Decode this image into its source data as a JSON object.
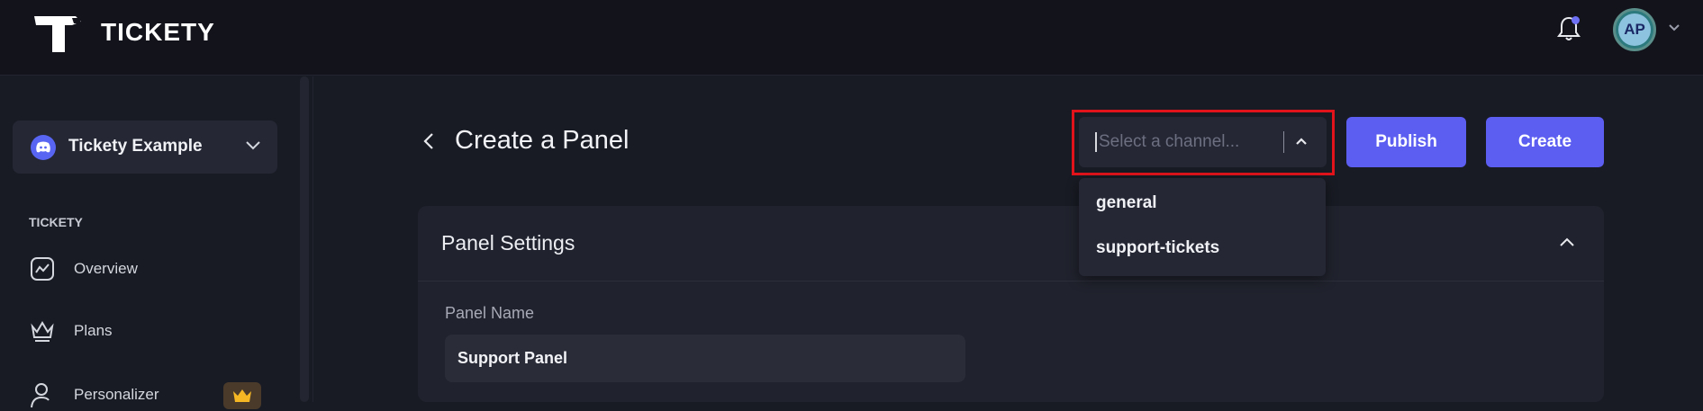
{
  "app": {
    "brand": "TICKETY",
    "avatar_initials": "AP",
    "accent_color": "#5b5ef1"
  },
  "sidebar": {
    "server_name": "Tickety Example",
    "section_label": "TICKETY",
    "items": [
      {
        "label": "Overview",
        "icon": "chart-icon"
      },
      {
        "label": "Plans",
        "icon": "crown-outline-icon"
      },
      {
        "label": "Personalizer",
        "icon": "user-edit-icon"
      }
    ]
  },
  "header": {
    "title": "Create a Panel"
  },
  "channel_select": {
    "placeholder": "Select a channel...",
    "options": [
      "general",
      "support-tickets"
    ]
  },
  "actions": {
    "publish_label": "Publish",
    "create_label": "Create"
  },
  "panel_settings": {
    "title": "Panel Settings",
    "panel_name_label": "Panel Name",
    "panel_name_value": "Support Panel"
  }
}
